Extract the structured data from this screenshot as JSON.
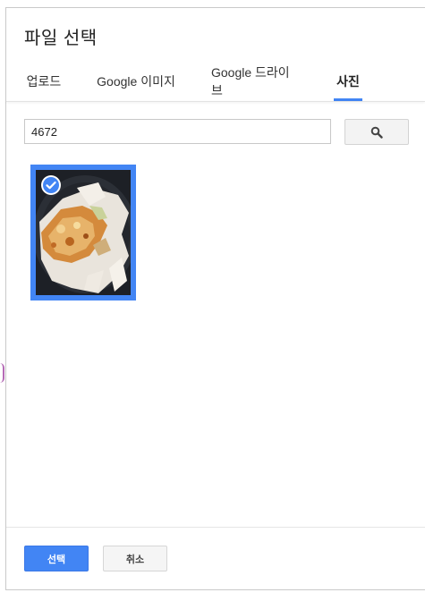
{
  "dialog": {
    "title": "파일 선택"
  },
  "tabs": [
    {
      "label": "업로드",
      "active": false
    },
    {
      "label": "Google 이미지",
      "active": false
    },
    {
      "label": "Google 드라이브",
      "active": false
    },
    {
      "label": "사진",
      "active": true
    }
  ],
  "search": {
    "value": "4672",
    "button_icon": "search-icon"
  },
  "photos": [
    {
      "selected": true,
      "icon": "check-circle-icon"
    }
  ],
  "footer": {
    "select_label": "선택",
    "cancel_label": "취소"
  },
  "colors": {
    "accent": "#4285f4"
  }
}
